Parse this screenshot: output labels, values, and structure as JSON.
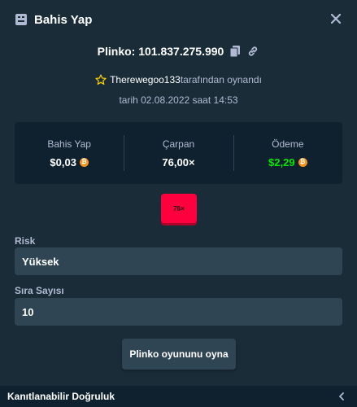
{
  "header": {
    "title": "Bahis Yap"
  },
  "game": {
    "id_text": "Plinko: 101.837.275.990"
  },
  "player": {
    "username": "Therewegoo133",
    "suffix": "tarafından oynandı"
  },
  "date_text": "tarih 02.08.2022 saat 14:53",
  "stats": {
    "bet_label": "Bahis Yap",
    "bet_value": "$0,03",
    "multiplier_label": "Çarpan",
    "multiplier_value": "76,00×",
    "payout_label": "Ödeme",
    "payout_value": "$2,29"
  },
  "result_chip": "76×",
  "risk": {
    "label": "Risk",
    "value": "Yüksek"
  },
  "rows": {
    "label": "Sıra Sayısı",
    "value": "10"
  },
  "play_button": "Plinko oyununu oyna",
  "footer": {
    "label": "Kanıtlanabilir Doğruluk"
  },
  "colors": {
    "background": "#1a2c38",
    "panel": "#0f212e",
    "input": "#2f4553",
    "payout_green": "#00e701",
    "chip_red": "#ff003f",
    "coin_orange": "#f7931a"
  }
}
